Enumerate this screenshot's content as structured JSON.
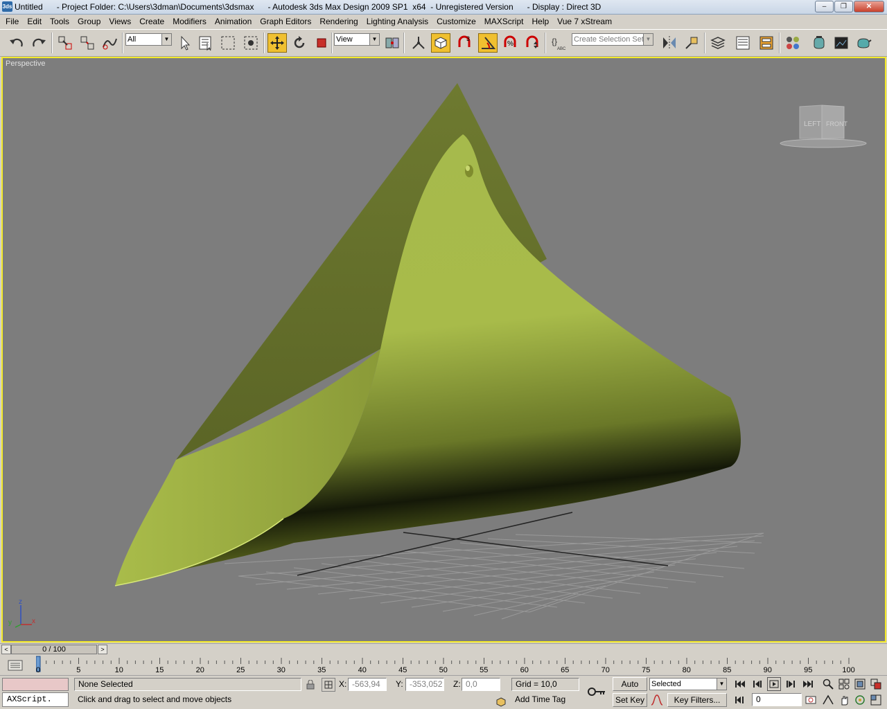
{
  "window": {
    "title": "Untitled      - Project Folder: C:\\Users\\3dman\\Documents\\3dsmax      - Autodesk 3ds Max Design 2009 SP1  x64  - Unregistered Version      - Display : Direct 3D",
    "app_icon_text": "3ds",
    "minimize": "‒",
    "restore": "❐",
    "close": "✕"
  },
  "menu": [
    "File",
    "Edit",
    "Tools",
    "Group",
    "Views",
    "Create",
    "Modifiers",
    "Animation",
    "Graph Editors",
    "Rendering",
    "Lighting Analysis",
    "Customize",
    "MAXScript",
    "Help",
    "Vue 7 xStream"
  ],
  "toolbar": {
    "selection_filter": "All",
    "reference_coord": "View",
    "named_selection_placeholder": "Create Selection Set",
    "icons": [
      "undo-icon",
      "redo-icon",
      "select-and-link-icon",
      "unlink-icon",
      "bind-space-warp-icon",
      "select-object-icon",
      "select-by-name-icon",
      "rectangular-selection-icon",
      "window-crossing-icon",
      "select-and-move-icon",
      "select-and-rotate-icon",
      "select-and-scale-icon",
      "use-pivot-center-icon",
      "select-manipulate-icon",
      "keyboard-shortcut-override-icon",
      "snaps-toggle-icon",
      "angle-snap-icon",
      "percent-snap-icon",
      "spinner-snap-icon",
      "edit-named-selection-icon",
      "mirror-icon",
      "align-icon",
      "layer-manager-icon",
      "curve-editor-icon",
      "schematic-view-icon",
      "material-editor-icon",
      "render-setup-icon",
      "rendered-frame-window-icon",
      "quick-render-icon"
    ]
  },
  "viewport": {
    "label": "Perspective",
    "viewcube": {
      "left": "LEFT",
      "front": "FRONT"
    },
    "axis": {
      "x": "x",
      "y": "y",
      "z": "z"
    },
    "object_color": "#a8bb4a",
    "background": "#7d7d7d",
    "active_border": "#f4ea2a"
  },
  "timeslider": {
    "position": "0 / 100",
    "prev": "<",
    "next": ">"
  },
  "trackbar": {
    "ticks": [
      "0",
      "5",
      "10",
      "15",
      "20",
      "25",
      "30",
      "35",
      "40",
      "45",
      "50",
      "55",
      "60",
      "65",
      "70",
      "75",
      "80",
      "85",
      "90",
      "95",
      "100"
    ]
  },
  "status": {
    "maxscript_listener": "AXScript.",
    "selection_info": "None Selected",
    "prompt": "Click and drag to select and move objects",
    "x_label": "X:",
    "x_value": "-563,94",
    "y_label": "Y:",
    "y_value": "-353,052",
    "z_label": "Z:",
    "z_value": "0,0",
    "grid": "Grid = 10,0",
    "add_time_tag": "Add Time Tag",
    "auto_key": "Auto Key",
    "set_key": "Set Key",
    "key_mode": "Selected",
    "key_filters": "Key Filters...",
    "current_frame": "0"
  }
}
